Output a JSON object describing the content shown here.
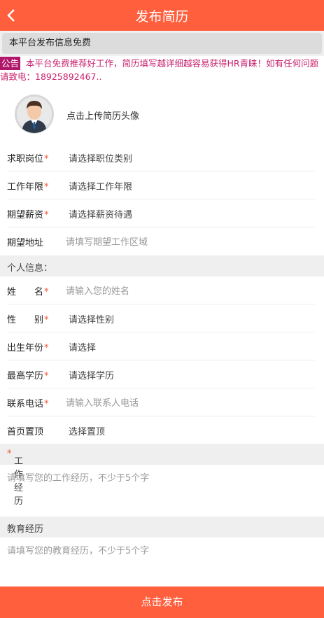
{
  "header": {
    "title": "发布简历",
    "back_icon": "chevron-left-icon"
  },
  "free_notice": "本平台发布信息免费",
  "announcement": {
    "tag": "公告",
    "text": "本平台免费推荐好工作，简历填写越详细越容易获得HR青睐！如有任何问题请致电：18925892467.."
  },
  "avatar": {
    "label": "点击上传简历头像"
  },
  "job_fields": [
    {
      "label": "求职岗位",
      "required": true,
      "value": "请选择职位类别"
    },
    {
      "label": "工作年限",
      "required": true,
      "value": "请选择工作年限"
    },
    {
      "label": "期望薪资",
      "required": true,
      "value": "请选择薪资待遇"
    },
    {
      "label": "期望地址",
      "required": false,
      "placeholder": "请填写期望工作区域"
    }
  ],
  "personal_section": "个人信息：",
  "personal_fields": [
    {
      "label": "姓　　名",
      "required": true,
      "placeholder": "请输入您的姓名"
    },
    {
      "label": "性　　别",
      "required": true,
      "value": "请选择性别"
    },
    {
      "label": "出生年份",
      "required": true,
      "value": "请选择"
    },
    {
      "label": "最高学历",
      "required": true,
      "value": "请选择学历"
    },
    {
      "label": "联系电话",
      "required": true,
      "placeholder": "请输入联系人电话"
    },
    {
      "label": "首页置顶",
      "required": false,
      "value": "选择置顶"
    }
  ],
  "work_section": {
    "label": "工作经历",
    "required": true,
    "placeholder": "请填写您的工作经历，不少于5个字"
  },
  "edu_section": {
    "label": "教育经历",
    "placeholder": "请填写您的教育经历，不少于5个字"
  },
  "submit_label": "点击发布",
  "colors": {
    "brand": "#ff5f3d",
    "required_star": "#f05a3a",
    "notice_text": "#c8206e"
  }
}
